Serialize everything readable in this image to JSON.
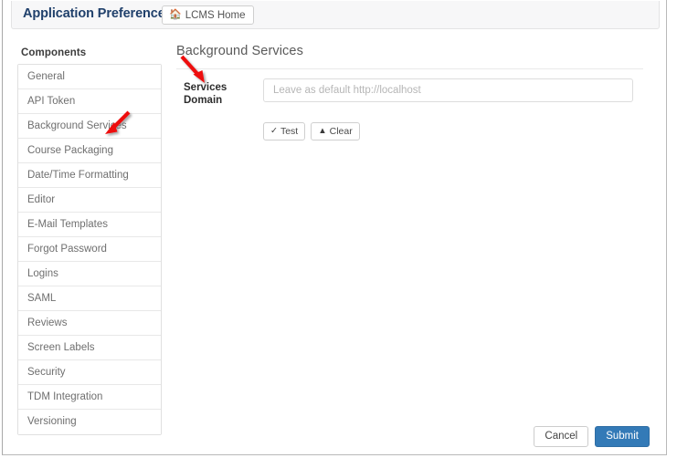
{
  "header": {
    "app_title": "Application Preferences",
    "home_button": {
      "label": "LCMS Home",
      "icon": "home-icon"
    }
  },
  "sidebar": {
    "heading": "Components",
    "items": [
      {
        "label": "General"
      },
      {
        "label": "API Token"
      },
      {
        "label": "Background Services"
      },
      {
        "label": "Course Packaging"
      },
      {
        "label": "Date/Time Formatting"
      },
      {
        "label": "Editor"
      },
      {
        "label": "E-Mail Templates"
      },
      {
        "label": "Forgot Password"
      },
      {
        "label": "Logins"
      },
      {
        "label": "SAML"
      },
      {
        "label": "Reviews"
      },
      {
        "label": "Screen Labels"
      },
      {
        "label": "Security"
      },
      {
        "label": "TDM Integration"
      },
      {
        "label": "Versioning"
      }
    ]
  },
  "main": {
    "section_title": "Background Services",
    "field": {
      "label_line1": "Services",
      "label_line2": "Domain",
      "value": "",
      "placeholder": "Leave as default http://localhost"
    },
    "buttons": {
      "test": {
        "label": "Test",
        "icon": "check-icon"
      },
      "clear": {
        "label": "Clear",
        "icon": "eraser-icon"
      }
    }
  },
  "footer": {
    "cancel_label": "Cancel",
    "submit_label": "Submit"
  },
  "annotations": {
    "arrow_color": "#ee1111",
    "arrow_sidebar_target": "Background Services",
    "arrow_field_target": "Services Domain"
  },
  "colors": {
    "title": "#20406b",
    "primary": "#337ab7",
    "primary_border": "#2e6da4",
    "section_title": "#5a5a5a",
    "sidebar_item_text": "#6f6f6f",
    "topbar_bg": "#f7f7f8",
    "border": "#e0e0e0"
  }
}
